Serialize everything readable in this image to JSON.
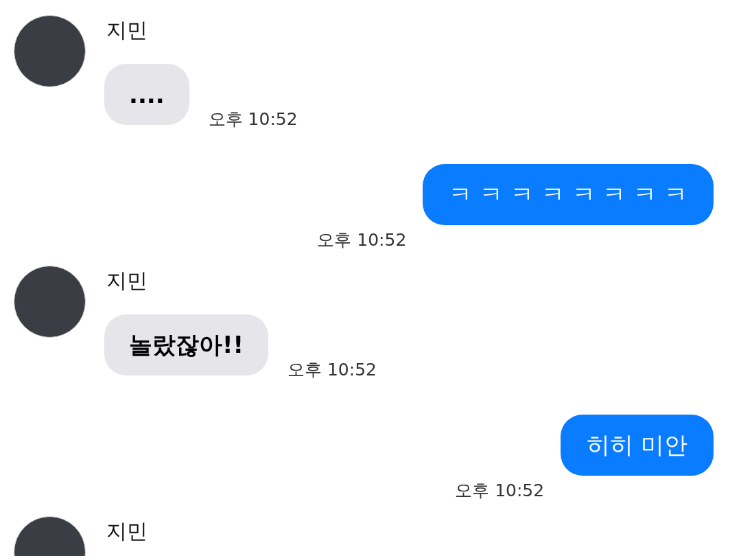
{
  "messages": [
    {
      "kind": "incoming",
      "sender": "지민",
      "text": "....",
      "time": "오후 10:52"
    },
    {
      "kind": "outgoing",
      "text": "ㅋ ㅋ ㅋ ㅋ ㅋ ㅋ ㅋ ㅋ",
      "time": "오후 10:52"
    },
    {
      "kind": "incoming",
      "sender": "지민",
      "text": "놀랐잖아!!",
      "time": "오후 10:52"
    },
    {
      "kind": "outgoing",
      "text": "히히 미안",
      "time": "오후 10:52"
    },
    {
      "kind": "incoming",
      "sender": "지민"
    }
  ]
}
